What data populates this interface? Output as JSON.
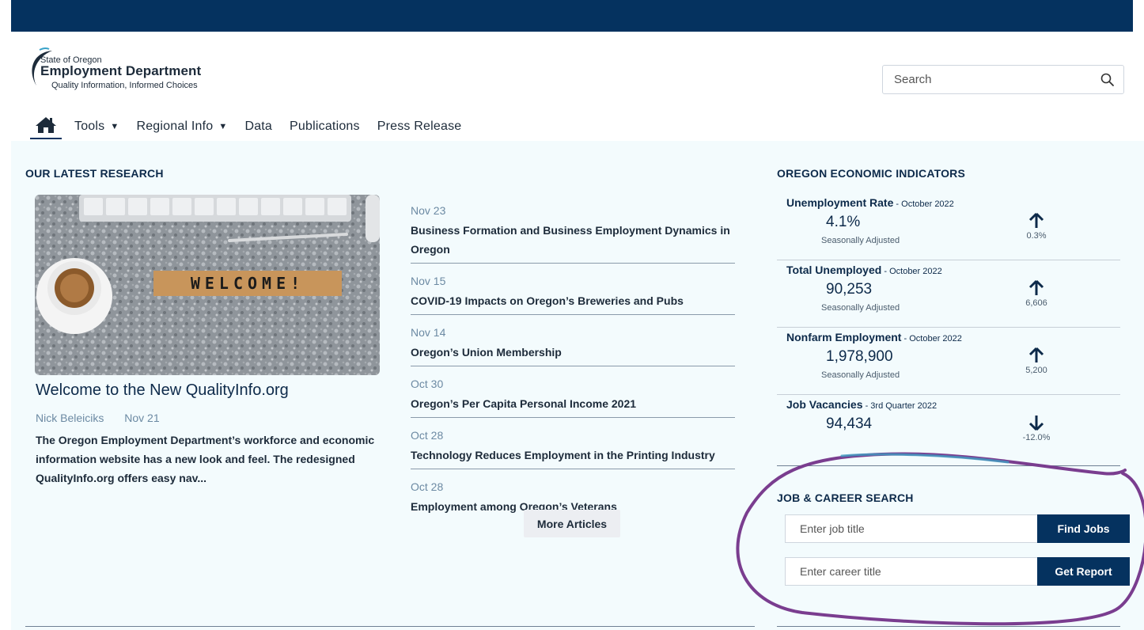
{
  "header": {
    "logo_line1": "State of Oregon",
    "logo_line2": "Employment Department",
    "logo_line3": "Quality Information, Informed Choices",
    "search_placeholder": "Search"
  },
  "nav": {
    "items": [
      {
        "label": "Tools",
        "dropdown": true
      },
      {
        "label": "Regional Info",
        "dropdown": true
      },
      {
        "label": "Data",
        "dropdown": false
      },
      {
        "label": "Publications",
        "dropdown": false
      },
      {
        "label": "Press Release",
        "dropdown": false
      }
    ],
    "caret": "▼"
  },
  "research": {
    "section_title": "OUR LATEST RESEARCH",
    "image_text": "WELCOME!",
    "feature": {
      "title": "Welcome to the New QualityInfo.org",
      "author": "Nick Beleiciks",
      "date": "Nov 21",
      "description": "The Oregon Employment Department’s workforce and economic information website has a new look and feel. The redesigned QualityInfo.org offers easy nav..."
    },
    "articles": [
      {
        "date": "Nov 23",
        "title": "Business Formation and Business Employment Dynamics in Oregon"
      },
      {
        "date": "Nov 15",
        "title": "COVID-19 Impacts on Oregon’s Breweries and Pubs"
      },
      {
        "date": "Nov 14",
        "title": "Oregon’s Union Membership"
      },
      {
        "date": "Oct 30",
        "title": "Oregon’s Per Capita Personal Income 2021"
      },
      {
        "date": "Oct 28",
        "title": "Technology Reduces Employment in the Printing Industry"
      },
      {
        "date": "Oct 28",
        "title": "Employment among Oregon’s Veterans"
      }
    ],
    "more_label": "More Articles"
  },
  "indicators": {
    "section_title": "OREGON ECONOMIC INDICATORS",
    "items": [
      {
        "name": "Unemployment Rate",
        "period": " - October 2022",
        "value": "4.1%",
        "note": "Seasonally Adjusted",
        "direction": "up",
        "change": "0.3%"
      },
      {
        "name": "Total Unemployed",
        "period": " - October 2022",
        "value": "90,253",
        "note": "Seasonally Adjusted",
        "direction": "up",
        "change": "6,606"
      },
      {
        "name": "Nonfarm Employment",
        "period": " - October 2022",
        "value": "1,978,900",
        "note": "Seasonally Adjusted",
        "direction": "up",
        "change": "5,200"
      },
      {
        "name": "Job Vacancies",
        "period": " - 3rd Quarter 2022",
        "value": "94,434",
        "note": "",
        "direction": "down",
        "change": "-12.0%"
      }
    ]
  },
  "job_search": {
    "section_title": "JOB & CAREER SEARCH",
    "job_placeholder": "Enter job title",
    "job_button": "Find Jobs",
    "career_placeholder": "Enter career title",
    "career_button": "Get Report"
  },
  "colors": {
    "brand_navy": "#05325f",
    "content_bg": "#f3fbfd",
    "annotation_stroke": "#7a3d8f"
  }
}
